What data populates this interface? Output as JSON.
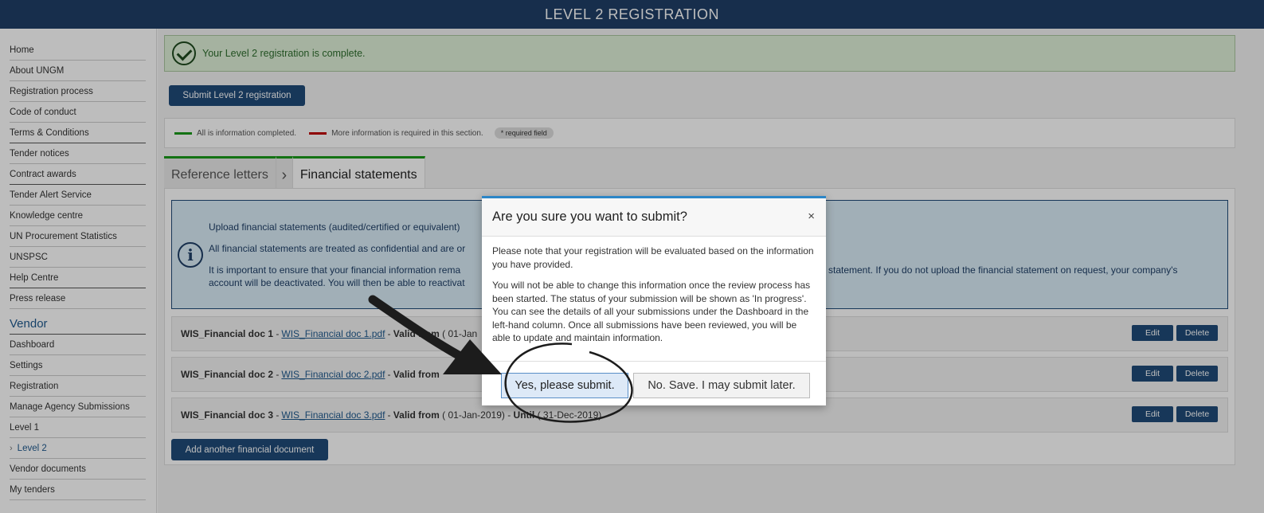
{
  "header": {
    "title": "LEVEL 2 REGISTRATION"
  },
  "sidebar": {
    "items": [
      {
        "label": "Home"
      },
      {
        "label": "About UNGM"
      },
      {
        "label": "Registration process"
      },
      {
        "label": "Code of conduct"
      },
      {
        "label": "Terms & Conditions"
      },
      {
        "label": "Tender notices"
      },
      {
        "label": "Contract awards"
      },
      {
        "label": "Tender Alert Service"
      },
      {
        "label": "Knowledge centre"
      },
      {
        "label": "UN Procurement Statistics"
      },
      {
        "label": "UNSPSC"
      },
      {
        "label": "Help Centre"
      },
      {
        "label": "Press release"
      }
    ],
    "section_title": "Vendor",
    "vendor_items": [
      {
        "label": "Dashboard"
      },
      {
        "label": "Settings"
      },
      {
        "label": "Registration"
      },
      {
        "label": "Manage Agency Submissions"
      },
      {
        "label": "Level 1"
      },
      {
        "label": "Level 2"
      },
      {
        "label": "Vendor documents"
      },
      {
        "label": "My tenders"
      }
    ]
  },
  "alert": {
    "message": "Your Level 2 registration is complete."
  },
  "toolbar": {
    "submit_label": "Submit Level 2 registration"
  },
  "legend": {
    "complete": "All is information completed.",
    "required": "More information is required in this section.",
    "required_field": "* required field"
  },
  "tabs": [
    {
      "label": "Reference letters"
    },
    {
      "label": "Financial statements"
    }
  ],
  "info": {
    "line1": "Upload financial statements (audited/certified or equivalent)",
    "line2": "All financial statements are treated as confidential and are or",
    "line3a": "It is important to ensure that your financial information rema",
    "line3b": "statement. If you do not upload the financial statement on request, your company's",
    "line4": "account will be deactivated. You will then be able to reactivat"
  },
  "documents": [
    {
      "name": "WIS_Financial doc 1",
      "file": "WIS_Financial doc 1.pdf",
      "valid_from_label": "Valid from",
      "valid_from": "( 01-Jan",
      "until_label": "",
      "until": ""
    },
    {
      "name": "WIS_Financial doc 2",
      "file": "WIS_Financial doc 2.pdf",
      "valid_from_label": "Valid from",
      "valid_from": "",
      "until_label": "",
      "until": ""
    },
    {
      "name": "WIS_Financial doc 3",
      "file": "WIS_Financial doc 3.pdf",
      "valid_from_label": "Valid from",
      "valid_from": "( 01-Jan-2019)",
      "until_label": "Until",
      "until": "( 31-Dec-2019)"
    }
  ],
  "row_actions": {
    "edit": "Edit",
    "delete": "Delete"
  },
  "add_doc_label": "Add another financial document",
  "modal": {
    "title": "Are you sure you want to submit?",
    "close": "×",
    "para1": "Please note that your registration will be evaluated based on the information you have provided.",
    "para2": "You will not be able to change this information once the review process has been started. The status of your submission will be shown as 'In progress'. You can see the details of all your submissions under the Dashboard in the left-hand column. Once all submissions have been reviewed, you will be able to update and maintain information.",
    "yes": "Yes, please submit.",
    "no": "No. Save. I may submit later."
  },
  "colors": {
    "header_bg": "#1f3f67",
    "primary": "#1f4b79",
    "success_bg": "#dff0d8",
    "info_bg": "#d9edf7",
    "complete": "#1a9a1a",
    "required": "#c00000",
    "modal_accent": "#2c86c7"
  }
}
